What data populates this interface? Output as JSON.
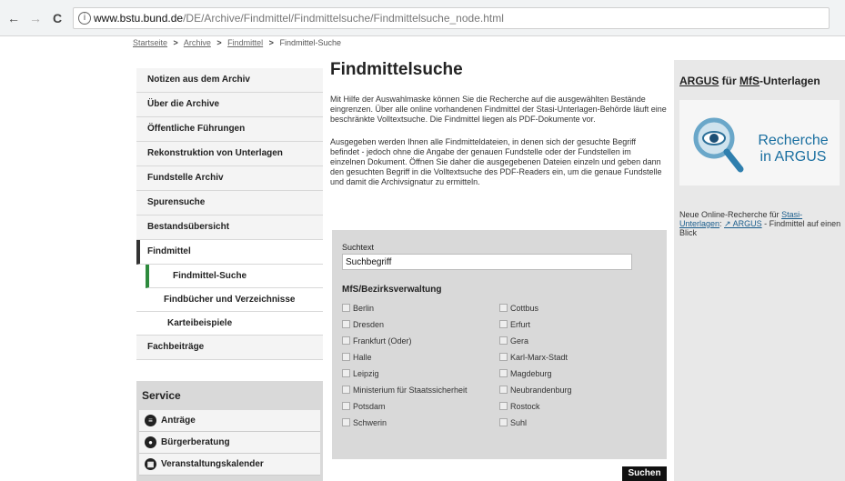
{
  "browser": {
    "back": "←",
    "forward": "→",
    "reload": "C",
    "info": "i",
    "url_host": "www.bstu.bund.de",
    "url_path": "/DE/Archive/Findmittel/Findmittelsuche/Findmittelsuche_node.html"
  },
  "breadcrumb": {
    "items": [
      "Startseite",
      "Archive",
      "Findmittel"
    ],
    "current": "Findmittel-Suche",
    "separator": ">"
  },
  "nav": {
    "items": [
      "Notizen aus dem Archiv",
      "Über die Archive",
      "Öffentliche Führungen",
      "Rekonstruktion von Unterlagen",
      "Fundstelle Archiv",
      "Spurensuche",
      "Bestandsübersicht",
      "Findmittel"
    ],
    "sub_items": [
      "Findmittel-Suche",
      "Findbücher und Verzeichnisse",
      "Karteibeispiele"
    ],
    "after": "Fachbeiträge"
  },
  "service": {
    "title": "Service",
    "items": [
      "Anträge",
      "Bürgerberatung",
      "Veranstaltungskalender"
    ]
  },
  "main": {
    "title": "Findmittelsuche",
    "para1": "Mit Hilfe der Auswahlmaske können Sie die Recherche auf die ausgewählten Bestände eingrenzen. Über alle online vorhandenen Findmittel der Stasi-Unterlagen-Behörde läuft eine beschränkte Volltextsuche. Die Findmittel liegen als PDF-Dokumente vor.",
    "para2": "Ausgegeben werden Ihnen alle Findmitteldateien, in denen sich der gesuchte Begriff befindet - jedoch ohne die Angabe der genauen Fundstelle oder der Fundstellen im einzelnen Dokument. Öffnen Sie daher die ausgegebenen Dateien einzeln und geben dann den gesuchten Begriff in die Volltextsuche des PDF-Readers ein, um die genaue Fundstelle und damit die Archivsignatur zu ermitteln."
  },
  "form": {
    "suchtext_label": "Suchtext",
    "suchtext_value": "Suchbegriff",
    "mfs_heading": "MfS/Bezirksverwaltung",
    "left_options": [
      "Berlin",
      "Dresden",
      "Frankfurt (Oder)",
      "Halle",
      "Leipzig",
      "Ministerium für Staatssicherheit",
      "Potsdam",
      "Schwerin"
    ],
    "right_options": [
      "Cottbus",
      "Erfurt",
      "Gera",
      "Karl-Marx-Stadt",
      "Magdeburg",
      "Neubrandenburg",
      "Rostock",
      "Suhl"
    ],
    "submit_label": "Suchen"
  },
  "right": {
    "heading_a": "ARGUS",
    "heading_b": " für ",
    "heading_c": "MfS",
    "heading_d": "-Unterlagen",
    "banner_text": "Recherche in ARGUS",
    "desc_a": "Neue Online-Recherche für ",
    "desc_b": "Stasi-Unterlagen",
    "desc_c": ": ",
    "desc_d": "↗ ARGUS",
    "desc_e": " - Findmittel auf einen Blick"
  },
  "colors": {
    "accent_green": "#2d8a3d",
    "argus_blue": "#1a6fa0"
  }
}
